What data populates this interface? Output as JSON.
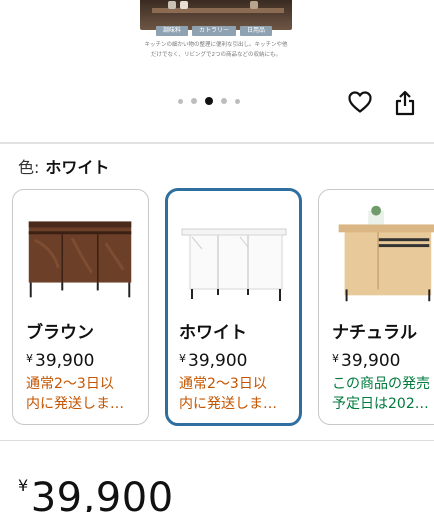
{
  "gallery": {
    "tags": [
      "調味料",
      "カトラリー",
      "日用品"
    ],
    "caption_line1": "キッチンの細かい物の整理に便利な引出し。キッチンや他",
    "caption_line2": "だけでなく、リビングで2つの商品などの収納にも。",
    "pager": {
      "total": 5,
      "active": 3
    }
  },
  "actions": {
    "favorite_icon": "heart-icon",
    "share_icon": "share-icon"
  },
  "color_selector": {
    "label": "色:",
    "selected": "ホワイト",
    "options": [
      {
        "name": "ブラウン",
        "yen": "¥",
        "price": "39,900",
        "shipping": "通常2～3日以内に発送しま…",
        "shipping_line1": "通常2～3日以",
        "shipping_line2": "内に発送しま…",
        "shipping_color": "#c45500",
        "selected": false
      },
      {
        "name": "ホワイト",
        "yen": "¥",
        "price": "39,900",
        "shipping": "通常2～3日以内に発送しま…",
        "shipping_line1": "通常2～3日以",
        "shipping_line2": "内に発送しま…",
        "shipping_color": "#c45500",
        "selected": true
      },
      {
        "name": "ナチュラル",
        "yen": "¥",
        "price": "39,900",
        "shipping_line1": "この商品の発売",
        "shipping_line2": "予定日は202…",
        "shipping_color": "#007a3d",
        "selected": false
      }
    ],
    "selected_border_color": "#2f6f9f"
  },
  "price": {
    "yen": "¥",
    "amount": "39,900"
  }
}
